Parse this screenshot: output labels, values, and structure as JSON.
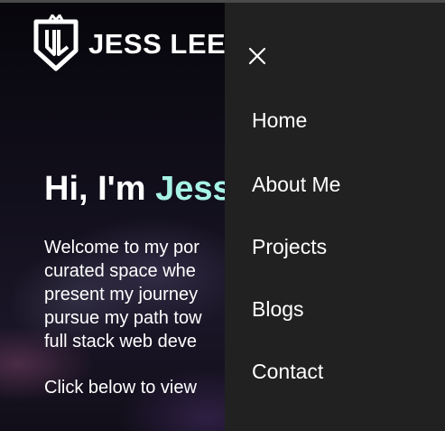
{
  "header": {
    "brand_name": "JESS LEE",
    "logo_icon": "jl-shield-logo-icon"
  },
  "hero": {
    "greeting_prefix": "Hi, I'm ",
    "greeting_name": "Jess",
    "intro_lines": [
      "Welcome to my por",
      "curated space whe",
      "present my journey",
      "pursue my path tow",
      "full stack web deve"
    ],
    "cta_text": "Click below to view",
    "accent_color": "#a7f3e6"
  },
  "drawer": {
    "close_icon": "close-icon",
    "background_color": "#212121",
    "nav_items": [
      {
        "label": "Home"
      },
      {
        "label": "About Me"
      },
      {
        "label": "Projects"
      },
      {
        "label": "Blogs"
      },
      {
        "label": "Contact"
      }
    ]
  }
}
